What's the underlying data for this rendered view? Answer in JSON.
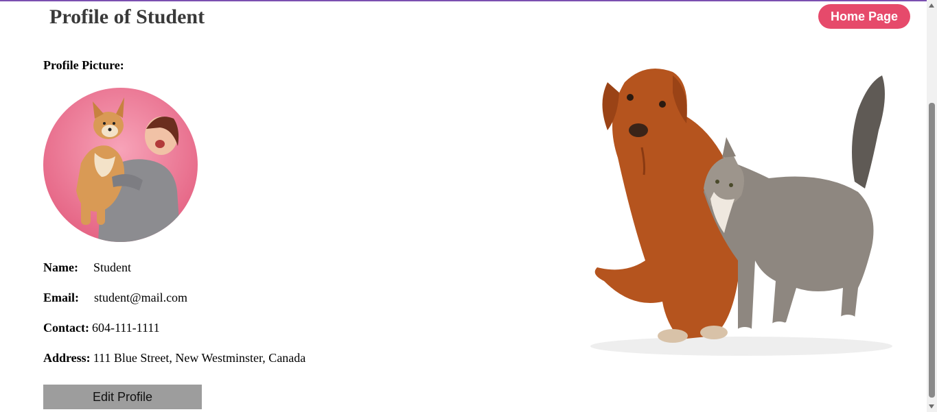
{
  "page": {
    "title": "Profile of Student"
  },
  "nav": {
    "home_label": "Home Page"
  },
  "profile": {
    "picture_label": "Profile Picture:",
    "name_label": "Name:",
    "name_value": "Student",
    "email_label": "Email:",
    "email_value": "student@mail.com",
    "contact_label": "Contact:",
    "contact_value": "604-111-1111",
    "address_label": "Address:",
    "address_value": "111 Blue Street, New Westminster, Canada"
  },
  "actions": {
    "edit_label": "Edit Profile"
  },
  "colors": {
    "accent": "#e64a6b",
    "top_bar": "#7b4fb0",
    "edit_button": "#9d9d9d"
  },
  "images": {
    "avatar": "avatar-photo-woman-with-corgi",
    "hero": "dog-and-cat-photo"
  }
}
